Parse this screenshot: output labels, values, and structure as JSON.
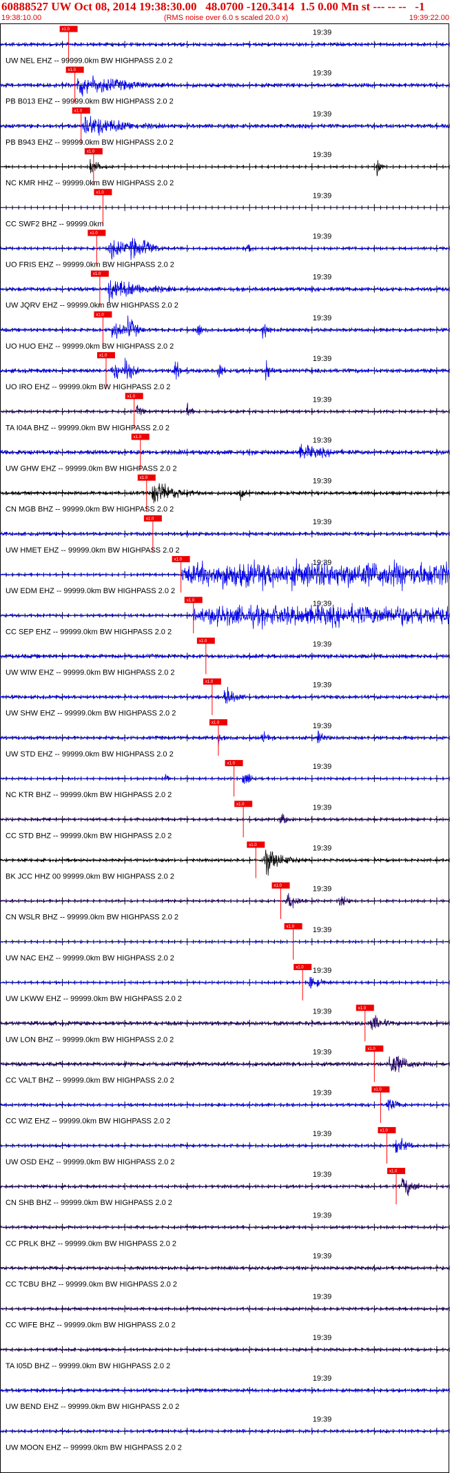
{
  "header": {
    "title": "60888527 UW Oct 08, 2014 19:38:30.00   48.0700 -120.3414  1.5 0.00 Mn st --- -- --   -1",
    "start_time": "19:38:10.00",
    "end_time": "19:39:22.00",
    "subtitle": "(RMS noise over 6.0 s scaled 20.0 x)"
  },
  "chart_data": {
    "type": "line",
    "x_start": "19:38:10.00",
    "x_end": "19:39:22.00",
    "x_range_seconds": [
      0,
      72
    ],
    "minute_marker": "19:39",
    "minute_marker_seconds": 50,
    "pick_label": "x1.0",
    "colors": {
      "blue": "#0000ee",
      "navy": "#220066",
      "black": "#000000",
      "pick": "#ee0000",
      "pick_line": "#ff0000"
    },
    "traces": [
      {
        "label": "UW NEL EHZ -- 99999.0km BW  HIGHPASS  2.0  2",
        "color": "blue",
        "pick_s": 11.0,
        "amp": 0.25,
        "events": []
      },
      {
        "label": "PB B013 EHZ -- 99999.0km BW  HIGHPASS  2.0  2",
        "color": "blue",
        "pick_s": 12.0,
        "amp": 0.3,
        "events": [
          [
            12.5,
            0.9,
            8
          ]
        ]
      },
      {
        "label": "PB B943 EHZ -- 99999.0km BW  HIGHPASS  2.0  2",
        "color": "blue",
        "pick_s": 13.0,
        "amp": 0.3,
        "events": [
          [
            13.5,
            0.9,
            7
          ]
        ]
      },
      {
        "label": "NC KMR HHZ -- 99999.0km BW  HIGHPASS  2.0  2",
        "color": "black",
        "pick_s": 15.0,
        "amp": 0.1,
        "events": [
          [
            14.5,
            0.7,
            1.5
          ],
          [
            60.5,
            0.8,
            0.6
          ]
        ]
      },
      {
        "label": "CC SWF2 BHZ -- 99999.0km",
        "color": "blue",
        "pick_s": 16.5,
        "amp": 0.03,
        "events": []
      },
      {
        "label": "UO FRIS EHZ -- 99999.0km BW  HIGHPASS  2.0  2",
        "color": "blue",
        "pick_s": 15.5,
        "amp": 0.2,
        "events": [
          [
            17.5,
            1.0,
            2.5
          ],
          [
            21.0,
            0.9,
            2
          ],
          [
            23.0,
            0.8,
            2
          ],
          [
            39.5,
            0.5,
            1
          ]
        ]
      },
      {
        "label": "UW JQRV EHZ -- 99999.0km BW  HIGHPASS  2.0  2",
        "color": "blue",
        "pick_s": 16.0,
        "amp": 0.3,
        "events": [
          [
            17.5,
            0.9,
            6
          ]
        ]
      },
      {
        "label": "UO HUO EHZ -- 99999.0km BW  HIGHPASS  2.0  2",
        "color": "blue",
        "pick_s": 16.5,
        "amp": 0.25,
        "events": [
          [
            18.0,
            1.0,
            1.5
          ],
          [
            20.5,
            1.0,
            1.5
          ],
          [
            31.5,
            0.8,
            1
          ],
          [
            42.0,
            0.8,
            1
          ]
        ]
      },
      {
        "label": "UO IRO EHZ -- 99999.0km BW  HIGHPASS  2.0  2",
        "color": "blue",
        "pick_s": 17.0,
        "amp": 0.3,
        "events": [
          [
            18.0,
            1.0,
            1.5
          ],
          [
            20.0,
            1.0,
            1.5
          ],
          [
            28.0,
            0.9,
            0.8
          ],
          [
            35.0,
            0.9,
            0.8
          ],
          [
            42.5,
            0.9,
            0.8
          ]
        ]
      },
      {
        "label": "TA I04A BHZ -- 99999.0km BW  HIGHPASS  2.0  2",
        "color": "navy",
        "pick_s": 21.5,
        "amp": 0.2,
        "events": [
          [
            22.0,
            0.5,
            1
          ],
          [
            30.0,
            0.6,
            0.8
          ]
        ]
      },
      {
        "label": "UW GHW EHZ -- 99999.0km BW  HIGHPASS  2.0  2",
        "color": "blue",
        "pick_s": 22.5,
        "amp": 0.35,
        "events": [
          [
            48.0,
            0.6,
            6
          ]
        ]
      },
      {
        "label": "CN MGB BHZ -- 99999.0km BW  HIGHPASS  2.0  2",
        "color": "black",
        "pick_s": 23.5,
        "amp": 0.25,
        "events": [
          [
            24.5,
            1.0,
            4
          ],
          [
            38.5,
            0.6,
            0.8
          ]
        ]
      },
      {
        "label": "UW HMET EHZ -- 99999.0km BW  HIGHPASS  2.0  2",
        "color": "blue",
        "pick_s": 24.5,
        "amp": 0.25,
        "events": []
      },
      {
        "label": "UW EDM EHZ -- 99999.0km BW  HIGHPASS  2.0  2",
        "color": "blue",
        "pick_s": 29.0,
        "amp": 0.15,
        "events": [],
        "noise_after_pick": 0.9
      },
      {
        "label": "CC SEP EHZ -- 99999.0km BW  HIGHPASS  2.0  2",
        "color": "blue",
        "pick_s": 31.0,
        "amp": 0.2,
        "events": [],
        "noise_after_pick": 0.7
      },
      {
        "label": "UW WIW EHZ -- 99999.0km BW  HIGHPASS  2.0  2",
        "color": "blue",
        "pick_s": 33.0,
        "amp": 0.3,
        "events": []
      },
      {
        "label": "UW SHW EHZ -- 99999.0km BW  HIGHPASS  2.0  2",
        "color": "blue",
        "pick_s": 34.0,
        "amp": 0.25,
        "events": [
          [
            36.0,
            0.9,
            2
          ]
        ]
      },
      {
        "label": "UW STD EHZ -- 99999.0km BW  HIGHPASS  2.0  2",
        "color": "blue",
        "pick_s": 35.0,
        "amp": 0.25,
        "events": [
          [
            35.0,
            0.7,
            1
          ],
          [
            42.0,
            0.5,
            1.5
          ],
          [
            51.0,
            0.6,
            1.2
          ]
        ]
      },
      {
        "label": "NC KTR BHZ -- 99999.0km BW  HIGHPASS  2.0  2",
        "color": "blue",
        "pick_s": 37.5,
        "amp": 0.15,
        "events": [
          [
            26.5,
            0.6,
            0.5
          ],
          [
            39.0,
            0.6,
            1.5
          ]
        ]
      },
      {
        "label": "CC STD BHZ -- 99999.0km BW  HIGHPASS  2.0  2",
        "color": "navy",
        "pick_s": 39.0,
        "amp": 0.2,
        "events": [
          [
            45.0,
            0.5,
            1.5
          ]
        ]
      },
      {
        "label": "BK JCC HHZ 00 99999.0km BW  HIGHPASS  2.0  2",
        "color": "black",
        "pick_s": 41.0,
        "amp": 0.2,
        "events": [
          [
            42.5,
            1.0,
            3
          ]
        ]
      },
      {
        "label": "CN WSLR BHZ -- 99999.0km BW  HIGHPASS  2.0  2",
        "color": "navy",
        "pick_s": 45.0,
        "amp": 0.15,
        "events": [
          [
            46.0,
            0.8,
            2
          ],
          [
            54.5,
            0.5,
            1.5
          ]
        ]
      },
      {
        "label": "UW NAC EHZ -- 99999.0km BW  HIGHPASS  2.0  2",
        "color": "blue",
        "pick_s": 47.0,
        "amp": 0.12,
        "events": []
      },
      {
        "label": "UW LKWW EHZ -- 99999.0km BW  HIGHPASS  2.0  2",
        "color": "blue",
        "pick_s": 48.5,
        "amp": 0.15,
        "events": [
          [
            49.5,
            0.6,
            2
          ]
        ]
      },
      {
        "label": "UW LON BHZ -- 99999.0km BW  HIGHPASS  2.0  2",
        "color": "navy",
        "pick_s": 58.5,
        "amp": 0.3,
        "events": [
          [
            59.5,
            0.8,
            2
          ]
        ]
      },
      {
        "label": "CC VALT BHZ -- 99999.0km BW  HIGHPASS  2.0  2",
        "color": "navy",
        "pick_s": 60.0,
        "amp": 0.3,
        "events": [
          [
            62.5,
            1.0,
            3
          ]
        ]
      },
      {
        "label": "CC WIZ EHZ -- 99999.0km BW  HIGHPASS  2.0  2",
        "color": "blue",
        "pick_s": 61.0,
        "amp": 0.2,
        "events": [
          [
            62.0,
            0.6,
            2
          ]
        ]
      },
      {
        "label": "UW OSD EHZ -- 99999.0km BW  HIGHPASS  2.0  2",
        "color": "blue",
        "pick_s": 62.0,
        "amp": 0.2,
        "events": [
          [
            63.5,
            0.7,
            2
          ]
        ]
      },
      {
        "label": "CN SHB BHZ -- 99999.0km BW  HIGHPASS  2.0  2",
        "color": "navy",
        "pick_s": 63.5,
        "amp": 0.2,
        "events": [
          [
            64.5,
            0.9,
            2
          ]
        ]
      },
      {
        "label": "CC PRLK BHZ -- 99999.0km BW  HIGHPASS  2.0  2",
        "color": "navy",
        "pick_s": null,
        "amp": 0.2,
        "events": []
      },
      {
        "label": "CC TCBU BHZ -- 99999.0km BW  HIGHPASS  2.0  2",
        "color": "navy",
        "pick_s": null,
        "amp": 0.25,
        "events": []
      },
      {
        "label": "CC WIFE BHZ -- 99999.0km BW  HIGHPASS  2.0  2",
        "color": "navy",
        "pick_s": null,
        "amp": 0.2,
        "events": []
      },
      {
        "label": "TA I05D BHZ -- 99999.0km BW  HIGHPASS  2.0  2",
        "color": "navy",
        "pick_s": null,
        "amp": 0.2,
        "events": []
      },
      {
        "label": "UW BEND EHZ -- 99999.0km BW  HIGHPASS  2.0  2",
        "color": "blue",
        "pick_s": null,
        "amp": 0.25,
        "events": []
      },
      {
        "label": "UW MOON EHZ -- 99999.0km BW  HIGHPASS  2.0  2",
        "color": "blue",
        "pick_s": null,
        "amp": 0.2,
        "events": []
      }
    ]
  }
}
